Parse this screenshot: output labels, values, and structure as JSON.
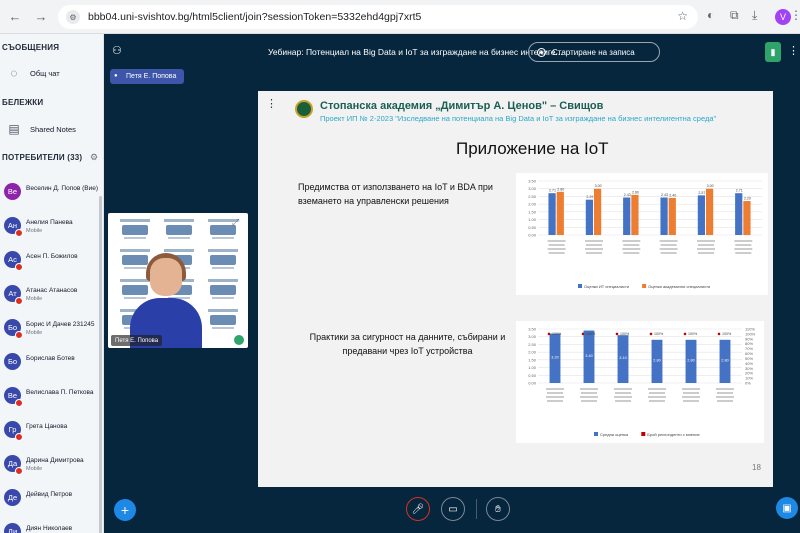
{
  "browser": {
    "url": "bbb04.uni-svishtov.bg/html5client/join?sessionToken=5332ehd4gpj7xrt5",
    "profile_initial": "V"
  },
  "sidebar": {
    "messages_heading": "СЪОБЩЕНИЯ",
    "public_chat": "Общ чат",
    "notes_heading": "БЕЛЕЖКИ",
    "shared_notes": "Shared Notes",
    "users_heading": "ПОТРЕБИТЕЛИ (33)",
    "users": [
      {
        "initials": "Ве",
        "name": "Веселин Д. Попов (Вие)",
        "sub": "",
        "color": "#8e24aa",
        "muted": false
      },
      {
        "initials": "Ан",
        "name": "Анелия Панева",
        "sub": "Mobile",
        "color": "#3949ab",
        "muted": true
      },
      {
        "initials": "Ас",
        "name": "Асен П. Божилов",
        "sub": "",
        "color": "#3949ab",
        "muted": true
      },
      {
        "initials": "Ат",
        "name": "Атанас Атанасов",
        "sub": "Mobile",
        "color": "#3949ab",
        "muted": true
      },
      {
        "initials": "Бо",
        "name": "Борис И Дачев 231245",
        "sub": "Mobile",
        "color": "#3949ab",
        "muted": true
      },
      {
        "initials": "Бо",
        "name": "Борислав Ботев",
        "sub": "",
        "color": "#3949ab",
        "muted": false
      },
      {
        "initials": "Ве",
        "name": "Велислава П. Петкова",
        "sub": "",
        "color": "#3949ab",
        "muted": true
      },
      {
        "initials": "Гр",
        "name": "Грета Цанова",
        "sub": "",
        "color": "#3949ab",
        "muted": true
      },
      {
        "initials": "Да",
        "name": "Дарина Димитрова",
        "sub": "Mobile",
        "color": "#3949ab",
        "muted": true
      },
      {
        "initials": "Де",
        "name": "Дейвид Петров",
        "sub": "",
        "color": "#3949ab",
        "muted": false
      },
      {
        "initials": "Ди",
        "name": "Диян Николаев",
        "sub": "",
        "color": "#3949ab",
        "muted": false
      }
    ]
  },
  "topbar": {
    "title": "Уебинар: Потенциал на Big Data и IoT за изграждане на бизнес интелиге...",
    "record_label": "Стартиране на записа"
  },
  "presenter_chip": "Петя Е. Попова",
  "webcam_label": "Петя Е. Попова",
  "slide": {
    "header_main": "Стопанска академия „Димитър А. Ценов\" – Свищов",
    "header_sub": "Проект ИП № 2-2023 \"Изследване на потенциала на Big Data и IoT за изграждане на бизнес интелигентна среда\"",
    "title": "Приложение на IoT",
    "section1": "Предимства от използването на IoT и BDA при вземането на управленски решения",
    "section2": "Практики за сигурност на данните, събирани и предавани чрез IoT устройства",
    "page": "18"
  },
  "chart_data": [
    {
      "type": "bar",
      "title": "",
      "categories": [
        "1",
        "2",
        "3",
        "4",
        "5",
        "6"
      ],
      "series": [
        {
          "name": "Оценки ИТ специалисти",
          "values": [
            2.71,
            2.29,
            2.43,
            2.43,
            2.57,
            2.71
          ],
          "color": "#4472c4"
        },
        {
          "name": "Оценки академични специалисти",
          "values": [
            2.8,
            3.0,
            2.6,
            2.4,
            3.0,
            2.2
          ],
          "color": "#ed7d31"
        }
      ],
      "ylim": [
        0,
        3.5
      ],
      "yticks": [
        "0.00",
        "0.50",
        "1.00",
        "1.50",
        "2.00",
        "2.50",
        "3.00",
        "3.50"
      ],
      "grid": true,
      "legend": "bottom"
    },
    {
      "type": "bar",
      "title": "",
      "categories": [
        "1",
        "2",
        "3",
        "4",
        "5",
        "6"
      ],
      "series": [
        {
          "name": "Средна оценка",
          "values": [
            3.2,
            3.4,
            3.1,
            2.8,
            2.8,
            2.8
          ],
          "color": "#4472c4"
        },
        {
          "name": "Брой респонденти с мнение",
          "values": [
            100,
            100,
            100,
            100,
            100,
            100
          ],
          "color": "#c00000"
        }
      ],
      "data_labels": [
        "3.20",
        "3.40",
        "3.10",
        "2.80",
        "2.80",
        "2.80"
      ],
      "point_labels": [
        "100%",
        "100%",
        "100%",
        "100%",
        "100%",
        "100%"
      ],
      "ylim": [
        0,
        3.5
      ],
      "yticks": [
        "0.00",
        "0.50",
        "1.00",
        "1.50",
        "2.00",
        "2.50",
        "3.00",
        "3.50"
      ],
      "y2ticks": [
        "0%",
        "10%",
        "20%",
        "30%",
        "40%",
        "50%",
        "60%",
        "70%",
        "80%",
        "90%",
        "100%",
        "110%"
      ],
      "grid": true,
      "legend": "bottom"
    }
  ]
}
